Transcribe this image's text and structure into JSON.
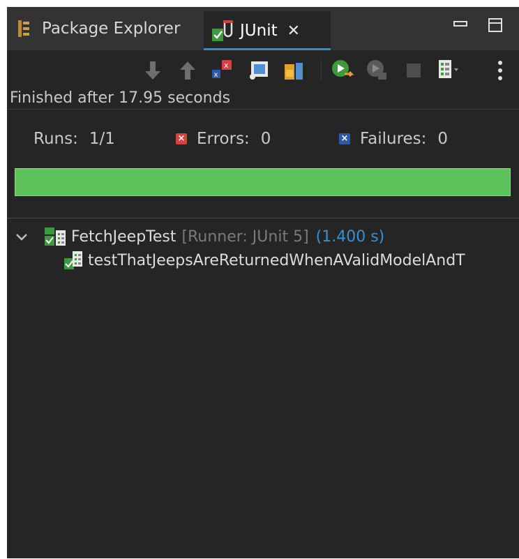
{
  "tabs": {
    "package_explorer": "Package Explorer",
    "junit": "JUnit"
  },
  "status": {
    "finished": "Finished after 17.95 seconds"
  },
  "counters": {
    "runs_label": "Runs:",
    "runs_value": "1/1",
    "errors_label": "Errors:",
    "errors_value": "0",
    "failures_label": "Failures:",
    "failures_value": "0"
  },
  "progress": {
    "fraction": 1.0,
    "color": "#5cc15a"
  },
  "tree": {
    "suite_name": "FetchJeepTest",
    "suite_runner": "[Runner: JUnit 5]",
    "suite_time": "(1.400 s)",
    "test_name": "testThatJeepsAreReturnedWhenAValidModelAndT"
  },
  "icons": {
    "toolbar": [
      "next-failure-icon",
      "previous-failure-icon",
      "show-failures-only-icon",
      "scroll-lock-icon",
      "lock-icon",
      "rerun-icon",
      "rerun-failures-first-icon",
      "stop-icon",
      "history-icon",
      "menu-icon"
    ]
  }
}
